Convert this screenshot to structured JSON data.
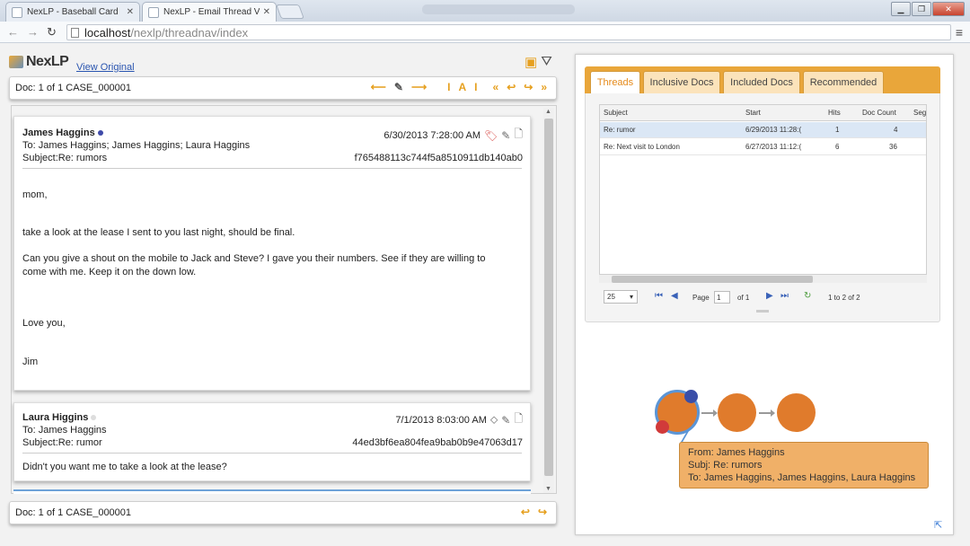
{
  "browser": {
    "tabs": [
      {
        "title": "NexLP - Baseball Card",
        "active": false
      },
      {
        "title": "NexLP - Email Thread Vie",
        "active": true
      }
    ],
    "url_host": "localhost",
    "url_path": "/nexlp/threadnav/index"
  },
  "app": {
    "logo": "NexLP",
    "view_original": "View Original"
  },
  "doc_nav": {
    "top_label": "Doc: 1 of 1 CASE_000001",
    "bottom_label": "Doc: 1 of 1 CASE_000001"
  },
  "emails": [
    {
      "from": "James Haggins",
      "to": "To: James Haggins; James Haggins; Laura Haggins",
      "subject": "Subject:Re: rumors",
      "date": "6/30/2013 7:28:00 AM",
      "hash": "f765488113c744f5a8510911db140ab0",
      "body": [
        "mom,",
        "take a look at the lease I sent to you last night, should be final.",
        "Can you give a shout on the mobile to Jack and Steve? I gave you their numbers. See if they are willing to",
        "come with me. Keep it on the down low.",
        "Love you,",
        "Jim"
      ]
    },
    {
      "from": "Laura Higgins",
      "to": "To: James Haggins",
      "subject": "Subject:Re: rumor",
      "date": "7/1/2013 8:03:00 AM",
      "hash": "44ed3bf6ea804fea9bab0b9e47063d17",
      "body": [
        "Didn't you want me to take a look at the lease?"
      ]
    }
  ],
  "tabs": [
    "Threads",
    "Inclusive Docs",
    "Included Docs",
    "Recommended"
  ],
  "grid": {
    "columns": [
      "Subject",
      "Start",
      "Hits",
      "Doc Count",
      "Seg"
    ],
    "rows": [
      {
        "subject": "Re: rumor",
        "start": "6/29/2013 11:28:(",
        "hits": "1",
        "doc_count": "4"
      },
      {
        "subject": "Re: Next visit to London",
        "start": "6/27/2013 11:12:(",
        "hits": "6",
        "doc_count": "36"
      }
    ]
  },
  "pager": {
    "page_size": "25",
    "page_label": "Page",
    "page_value": "1",
    "of_label": "of 1",
    "range": "1 to 2 of 2"
  },
  "tooltip": {
    "from": "From: James Haggins",
    "subject": "Subj: Re: rumors",
    "to": "To:   James Haggins, James Haggins, Laura Haggins"
  }
}
